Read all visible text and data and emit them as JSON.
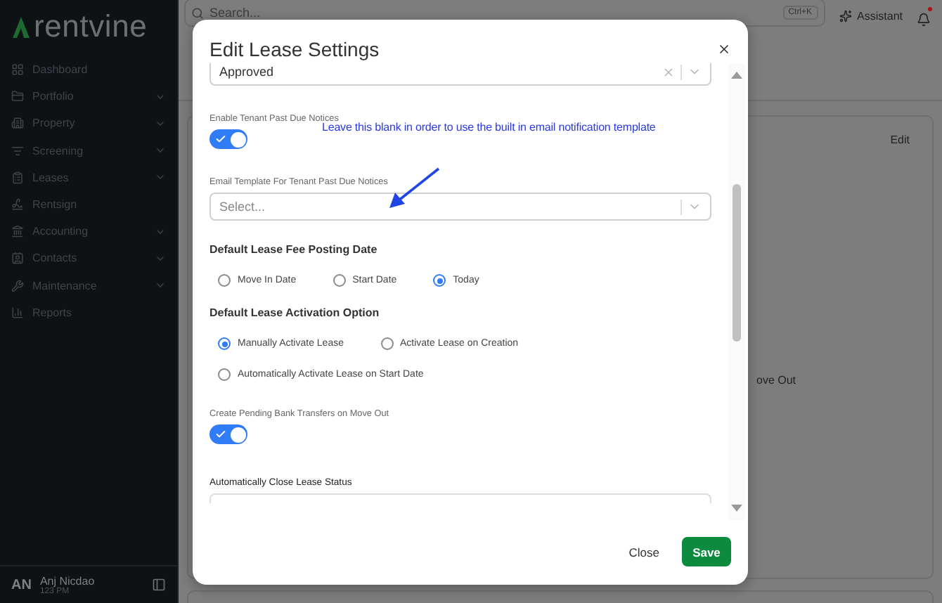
{
  "sidebar": {
    "logo": "rentvine",
    "items": [
      {
        "label": "Dashboard",
        "expandable": false
      },
      {
        "label": "Portfolio",
        "expandable": true
      },
      {
        "label": "Property",
        "expandable": true
      },
      {
        "label": "Screening",
        "expandable": true
      },
      {
        "label": "Leases",
        "expandable": true
      },
      {
        "label": "Rentsign",
        "expandable": false
      },
      {
        "label": "Accounting",
        "expandable": true
      },
      {
        "label": "Contacts",
        "expandable": true
      },
      {
        "label": "Maintenance",
        "expandable": true
      },
      {
        "label": "Reports",
        "expandable": false
      }
    ],
    "user": {
      "initials": "AN",
      "name": "Anj Nicdao",
      "time": "123 PM"
    }
  },
  "topbar": {
    "search_placeholder": "Search...",
    "shortcut": "Ctrl+K",
    "assistant": "Assistant",
    "unread": true
  },
  "background_card": {
    "action": "Edit",
    "text": "ove Out"
  },
  "modal": {
    "title": "Edit Lease Settings",
    "annotation": "Leave this blank in order to use the built in email notification template",
    "fields": [
      {
        "kind": "select",
        "value": "Approved"
      },
      {
        "kind": "toggle",
        "label": "Enable Tenant Past Due Notices",
        "on": true
      },
      {
        "kind": "select",
        "label": "Email Template For Tenant Past Due Notices",
        "placeholder": "Select..."
      },
      {
        "kind": "radio",
        "heading": "Default Lease Fee Posting Date",
        "options": [
          {
            "label": "Move In Date",
            "selected": false
          },
          {
            "label": "Start Date",
            "selected": false
          },
          {
            "label": "Today",
            "selected": true
          }
        ]
      },
      {
        "kind": "radio",
        "heading": "Default Lease Activation Option",
        "options": [
          {
            "label": "Manually Activate Lease",
            "selected": true
          },
          {
            "label": "Activate Lease on Creation",
            "selected": false
          },
          {
            "label": "Automatically Activate Lease on Start Date",
            "selected": false
          }
        ]
      },
      {
        "kind": "toggle",
        "label": "Create Pending Bank Transfers on Move Out",
        "on": true
      },
      {
        "kind": "select_cut",
        "label": "Automatically Close Lease Status"
      }
    ],
    "buttons": {
      "close": "Close",
      "save": "Save"
    }
  }
}
